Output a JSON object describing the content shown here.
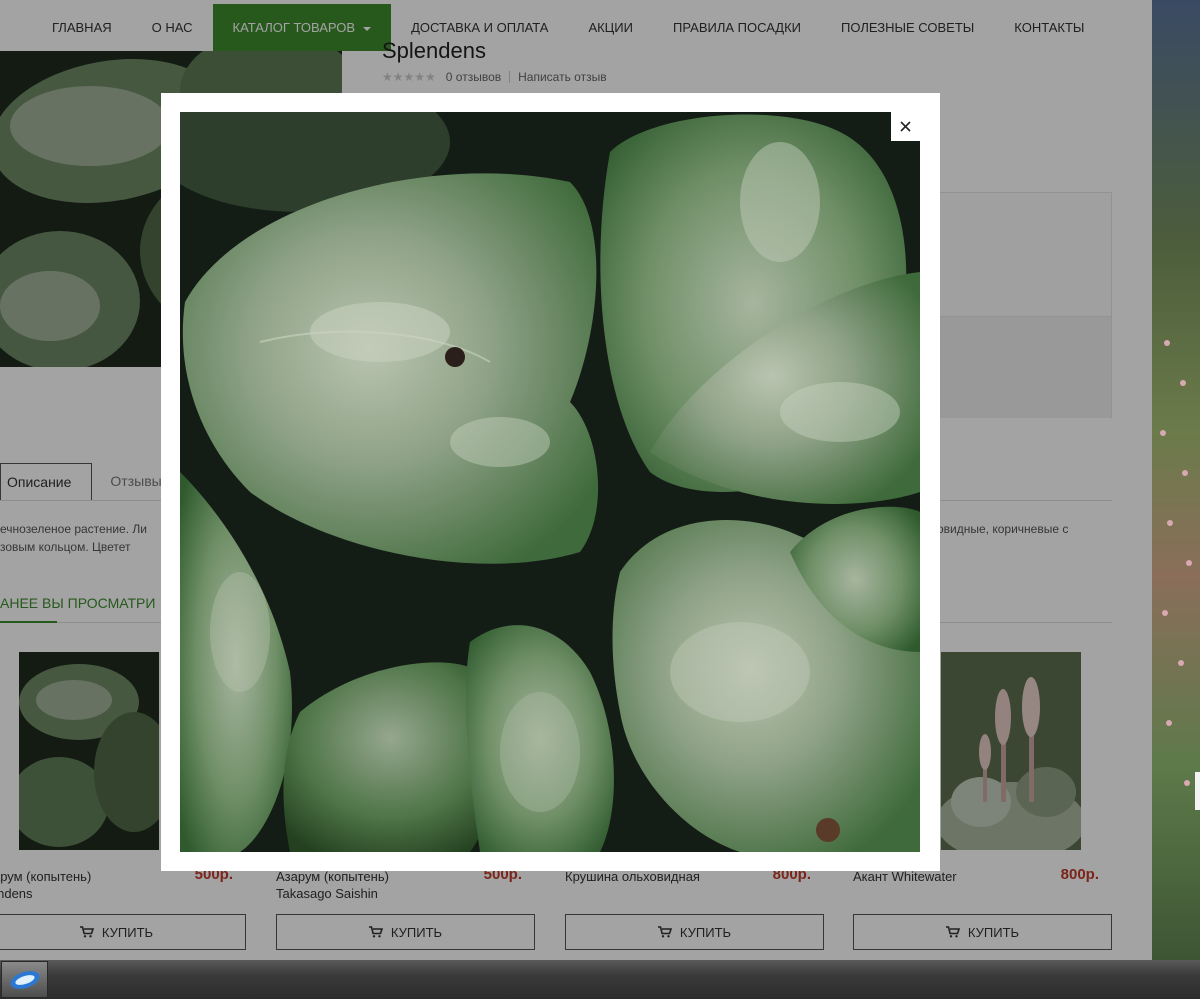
{
  "nav": {
    "items": [
      {
        "label": "ГЛАВНАЯ",
        "active": false
      },
      {
        "label": "О НАС",
        "active": false
      },
      {
        "label": "КАТАЛОГ ТОВАРОВ",
        "active": true
      },
      {
        "label": "ДОСТАВКА И ОПЛАТА",
        "active": false
      },
      {
        "label": "АКЦИИ",
        "active": false
      },
      {
        "label": "ПРАВИЛА ПОСАДКИ",
        "active": false
      },
      {
        "label": "ПОЛЕЗНЫЕ СОВЕТЫ",
        "active": false
      },
      {
        "label": "КОНТАКТЫ",
        "active": false
      }
    ]
  },
  "product": {
    "title": "Splendens",
    "reviews": "0 отзывов",
    "write_review": "Написать отзыв"
  },
  "tabs": {
    "description": "Описание",
    "reviews": "Отзывы"
  },
  "description": {
    "left_line1": "ечнозеленое растение. Ли",
    "left_line2": "зовым кольцом. Цветет",
    "right_line1": "нковидные, коричневые с"
  },
  "viewed": {
    "title": "АНЕЕ ВЫ ПРОСМАТРИ"
  },
  "cards": [
    {
      "name_line1": "зарум (копытень)",
      "name_line2": "lendens",
      "price": "500р.",
      "buy": "КУПИТЬ"
    },
    {
      "name_line1": "Азарум (копытень)",
      "name_line2": "Takasago Saishin",
      "price": "500р.",
      "buy": "КУПИТЬ"
    },
    {
      "name_line1": "Крушина ольховидная",
      "name_line2": "",
      "price": "800р.",
      "buy": "КУПИТЬ"
    },
    {
      "name_line1": "Акант Whitewater",
      "name_line2": "",
      "price": "800р.",
      "buy": "КУПИТЬ"
    }
  ],
  "lightbox": {
    "close_symbol": "×"
  },
  "colors": {
    "accent_green": "#3d8b2e",
    "price_red": "#c0392b"
  }
}
